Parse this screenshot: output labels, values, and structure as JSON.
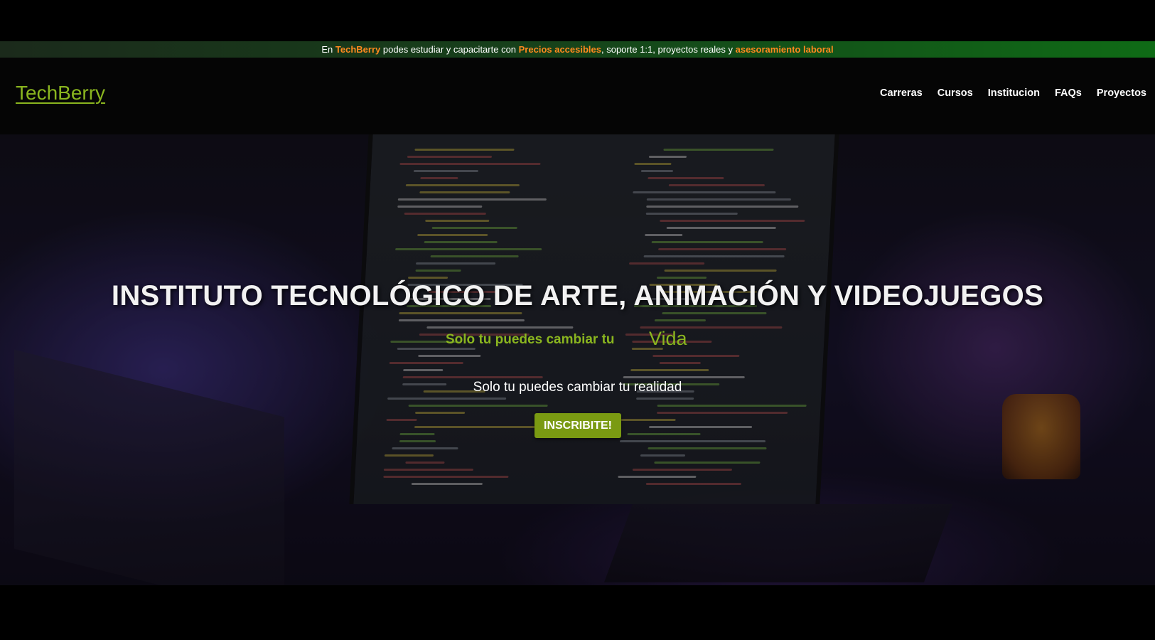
{
  "announcement": {
    "part1": "En ",
    "brand": "TechBerry",
    "part2": " podes estudiar y capacitarte con ",
    "highlight1": "Precios accesibles",
    "part3": ", soporte 1:1, proyectos reales y ",
    "highlight2": "asesoramiento laboral"
  },
  "header": {
    "logo": "TechBerry",
    "nav": [
      "Carreras",
      "Cursos",
      "Institucion",
      "FAQs",
      "Proyectos"
    ]
  },
  "hero": {
    "title": "INSTITUTO TECNOLÓGICO DE ARTE, ANIMACIÓN Y VIDEOJUEGOS",
    "typed_static": "Solo tu puedes cambiar tu",
    "typed_word": "Vida",
    "subtitle": "Solo tu puedes cambiar tu realidad",
    "cta_label": "INSCRIBITE!"
  },
  "colors": {
    "accent_green": "#8ab51f",
    "highlight_orange": "#ff8a1f",
    "cta_bg": "#7a9a12"
  }
}
